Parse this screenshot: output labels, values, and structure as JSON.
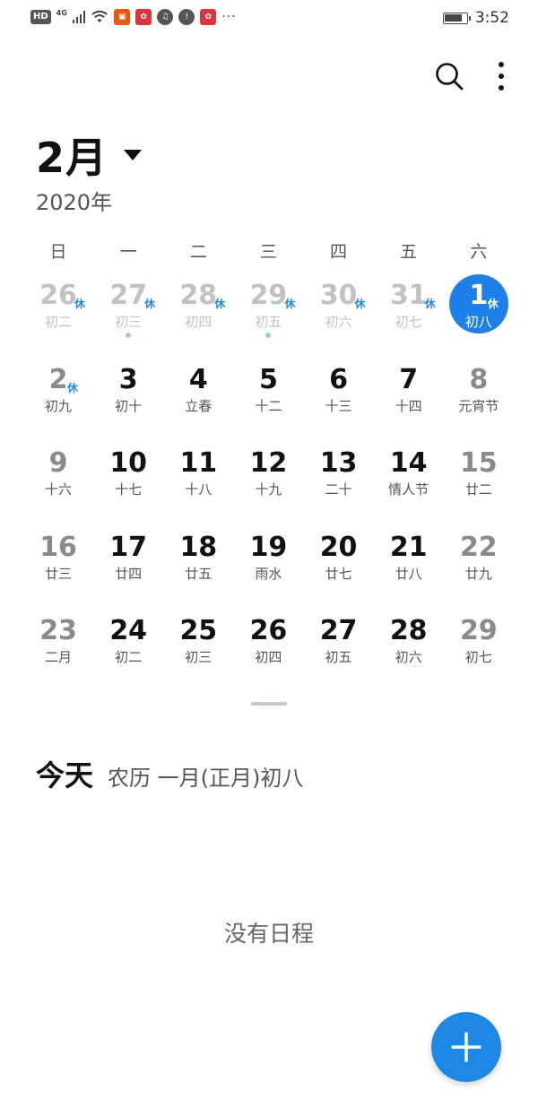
{
  "status_bar": {
    "hd": "HD",
    "network": "4G",
    "time": "3:52",
    "battery_level": 0.85,
    "icons": [
      "signal-icon",
      "wifi-icon",
      "app-notification-icon",
      "huawei-app-icon",
      "music-icon",
      "cloud-alert-icon",
      "huawei-store-icon"
    ],
    "more": "···"
  },
  "header": {
    "month": "2月",
    "year": "2020年"
  },
  "weekdays": [
    "日",
    "一",
    "二",
    "三",
    "四",
    "五",
    "六"
  ],
  "weeks": [
    [
      {
        "num": "26",
        "lunar": "初二",
        "badge": "休",
        "state": "dim"
      },
      {
        "num": "27",
        "lunar": "初三",
        "badge": "休",
        "state": "dim",
        "dot": true
      },
      {
        "num": "28",
        "lunar": "初四",
        "badge": "休",
        "state": "dim"
      },
      {
        "num": "29",
        "lunar": "初五",
        "badge": "休",
        "state": "dim",
        "dot": true
      },
      {
        "num": "30",
        "lunar": "初六",
        "badge": "休",
        "state": "dim"
      },
      {
        "num": "31",
        "lunar": "初七",
        "badge": "休",
        "state": "dim"
      },
      {
        "num": "1",
        "lunar": "初八",
        "badge": "休",
        "state": "today"
      }
    ],
    [
      {
        "num": "2",
        "lunar": "初九",
        "badge": "休",
        "state": "weekend"
      },
      {
        "num": "3",
        "lunar": "初十",
        "badge": "",
        "state": "weekday"
      },
      {
        "num": "4",
        "lunar": "立春",
        "badge": "",
        "state": "weekday"
      },
      {
        "num": "5",
        "lunar": "十二",
        "badge": "",
        "state": "weekday"
      },
      {
        "num": "6",
        "lunar": "十三",
        "badge": "",
        "state": "weekday"
      },
      {
        "num": "7",
        "lunar": "十四",
        "badge": "",
        "state": "weekday"
      },
      {
        "num": "8",
        "lunar": "元宵节",
        "badge": "",
        "state": "weekend"
      }
    ],
    [
      {
        "num": "9",
        "lunar": "十六",
        "badge": "",
        "state": "weekend"
      },
      {
        "num": "10",
        "lunar": "十七",
        "badge": "",
        "state": "weekday"
      },
      {
        "num": "11",
        "lunar": "十八",
        "badge": "",
        "state": "weekday"
      },
      {
        "num": "12",
        "lunar": "十九",
        "badge": "",
        "state": "weekday"
      },
      {
        "num": "13",
        "lunar": "二十",
        "badge": "",
        "state": "weekday"
      },
      {
        "num": "14",
        "lunar": "情人节",
        "badge": "",
        "state": "weekday"
      },
      {
        "num": "15",
        "lunar": "廿二",
        "badge": "",
        "state": "weekend"
      }
    ],
    [
      {
        "num": "16",
        "lunar": "廿三",
        "badge": "",
        "state": "weekend"
      },
      {
        "num": "17",
        "lunar": "廿四",
        "badge": "",
        "state": "weekday"
      },
      {
        "num": "18",
        "lunar": "廿五",
        "badge": "",
        "state": "weekday"
      },
      {
        "num": "19",
        "lunar": "雨水",
        "badge": "",
        "state": "weekday"
      },
      {
        "num": "20",
        "lunar": "廿七",
        "badge": "",
        "state": "weekday"
      },
      {
        "num": "21",
        "lunar": "廿八",
        "badge": "",
        "state": "weekday"
      },
      {
        "num": "22",
        "lunar": "廿九",
        "badge": "",
        "state": "weekend"
      }
    ],
    [
      {
        "num": "23",
        "lunar": "二月",
        "badge": "",
        "state": "weekend"
      },
      {
        "num": "24",
        "lunar": "初二",
        "badge": "",
        "state": "weekday"
      },
      {
        "num": "25",
        "lunar": "初三",
        "badge": "",
        "state": "weekday"
      },
      {
        "num": "26",
        "lunar": "初四",
        "badge": "",
        "state": "weekday"
      },
      {
        "num": "27",
        "lunar": "初五",
        "badge": "",
        "state": "weekday"
      },
      {
        "num": "28",
        "lunar": "初六",
        "badge": "",
        "state": "weekday"
      },
      {
        "num": "29",
        "lunar": "初七",
        "badge": "",
        "state": "weekend"
      }
    ]
  ],
  "today": {
    "title": "今天",
    "lunar": "农历 一月(正月)初八"
  },
  "schedule": {
    "empty": "没有日程"
  },
  "colors": {
    "accent": "#1e88e5",
    "today_circle": "#1e7fe8",
    "holiday_badge": "#1e88e5"
  }
}
